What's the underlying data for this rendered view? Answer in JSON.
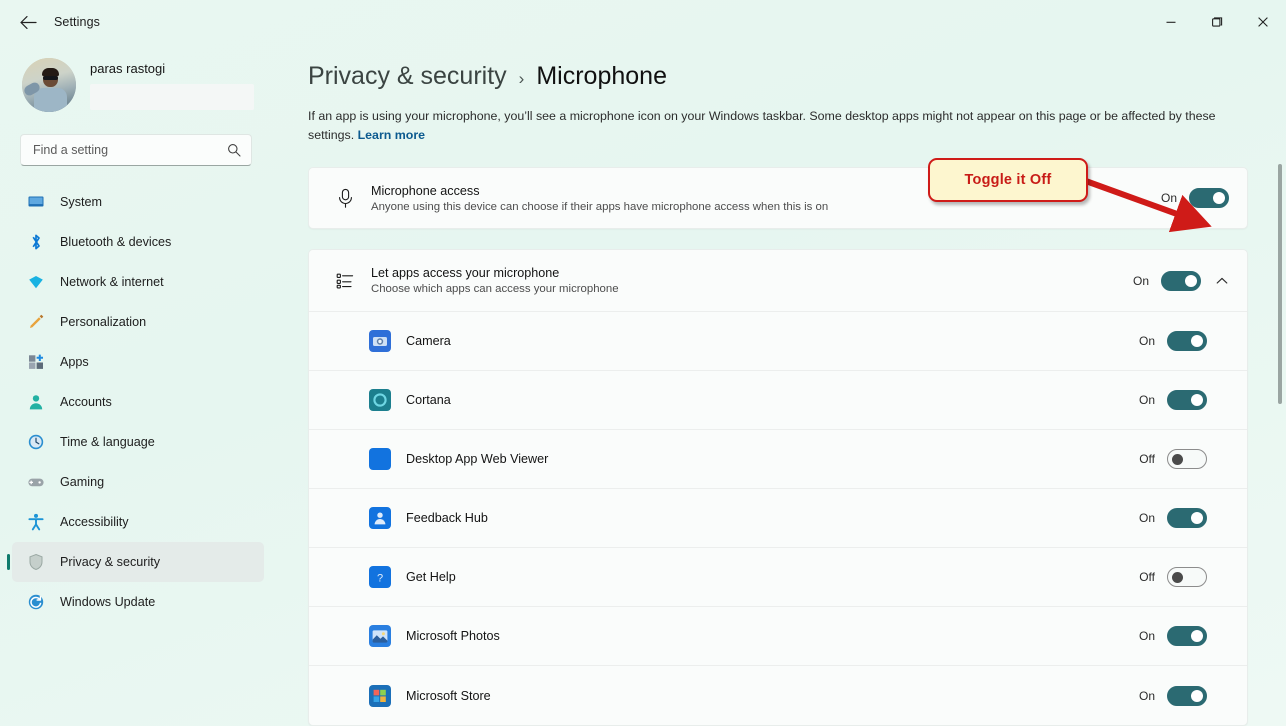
{
  "window": {
    "app_title": "Settings",
    "back_icon": "back-arrow-icon",
    "minimize_label": "—",
    "maximize_label": "❐",
    "close_label": "✕"
  },
  "sidebar": {
    "profile": {
      "name": "paras rastogi"
    },
    "search": {
      "placeholder": "Find a setting",
      "value": "",
      "icon": "search-icon"
    },
    "items": [
      {
        "label": "System",
        "icon": "system-icon",
        "active": false
      },
      {
        "label": "Bluetooth & devices",
        "icon": "bluetooth-icon",
        "active": false
      },
      {
        "label": "Network & internet",
        "icon": "network-icon",
        "active": false
      },
      {
        "label": "Personalization",
        "icon": "personalization-icon",
        "active": false
      },
      {
        "label": "Apps",
        "icon": "apps-icon",
        "active": false
      },
      {
        "label": "Accounts",
        "icon": "accounts-icon",
        "active": false
      },
      {
        "label": "Time & language",
        "icon": "time-icon",
        "active": false
      },
      {
        "label": "Gaming",
        "icon": "gaming-icon",
        "active": false
      },
      {
        "label": "Accessibility",
        "icon": "accessibility-icon",
        "active": false
      },
      {
        "label": "Privacy & security",
        "icon": "shield-icon",
        "active": true
      },
      {
        "label": "Windows Update",
        "icon": "update-icon",
        "active": false
      }
    ]
  },
  "main": {
    "breadcrumb": {
      "root": "Privacy & security",
      "separator": "›",
      "current": "Microphone"
    },
    "description": "If an app is using your microphone, you’ll see a microphone icon on your Windows taskbar. Some desktop apps might not appear on this page or be affected by these settings. ",
    "learn_more": "Learn more",
    "microphone_access": {
      "icon": "microphone-icon",
      "title": "Microphone access",
      "subtitle": "Anyone using this device can choose if their apps have microphone access when this is on",
      "state": "On",
      "on": true
    },
    "let_apps": {
      "icon": "list-icon",
      "title": "Let apps access your microphone",
      "subtitle": "Choose which apps can access your microphone",
      "state": "On",
      "on": true,
      "expand_icon": "chevron-up-icon"
    },
    "apps": [
      {
        "name": "Camera",
        "icon": "camera-app-icon",
        "state": "On",
        "on": true
      },
      {
        "name": "Cortana",
        "icon": "cortana-app-icon",
        "state": "On",
        "on": true
      },
      {
        "name": "Desktop App Web Viewer",
        "icon": "webviewer-app-icon",
        "state": "Off",
        "on": false
      },
      {
        "name": "Feedback Hub",
        "icon": "feedback-app-icon",
        "state": "On",
        "on": true
      },
      {
        "name": "Get Help",
        "icon": "gethelp-app-icon",
        "state": "Off",
        "on": false
      },
      {
        "name": "Microsoft Photos",
        "icon": "photos-app-icon",
        "state": "On",
        "on": true
      },
      {
        "name": "Microsoft Store",
        "icon": "store-app-icon",
        "state": "On",
        "on": true
      }
    ]
  },
  "annotation": {
    "text": "Toggle it Off",
    "box_fill": "#fdf6cf",
    "box_border": "#cf1b18",
    "text_color": "#c81c17",
    "arrow_color": "#cf1b18"
  },
  "colors": {
    "accent_toggle_on": "#2b6a72",
    "page_background": "#e9f7f1",
    "card_background": "#fafcfb",
    "link": "#0c5a8f"
  }
}
